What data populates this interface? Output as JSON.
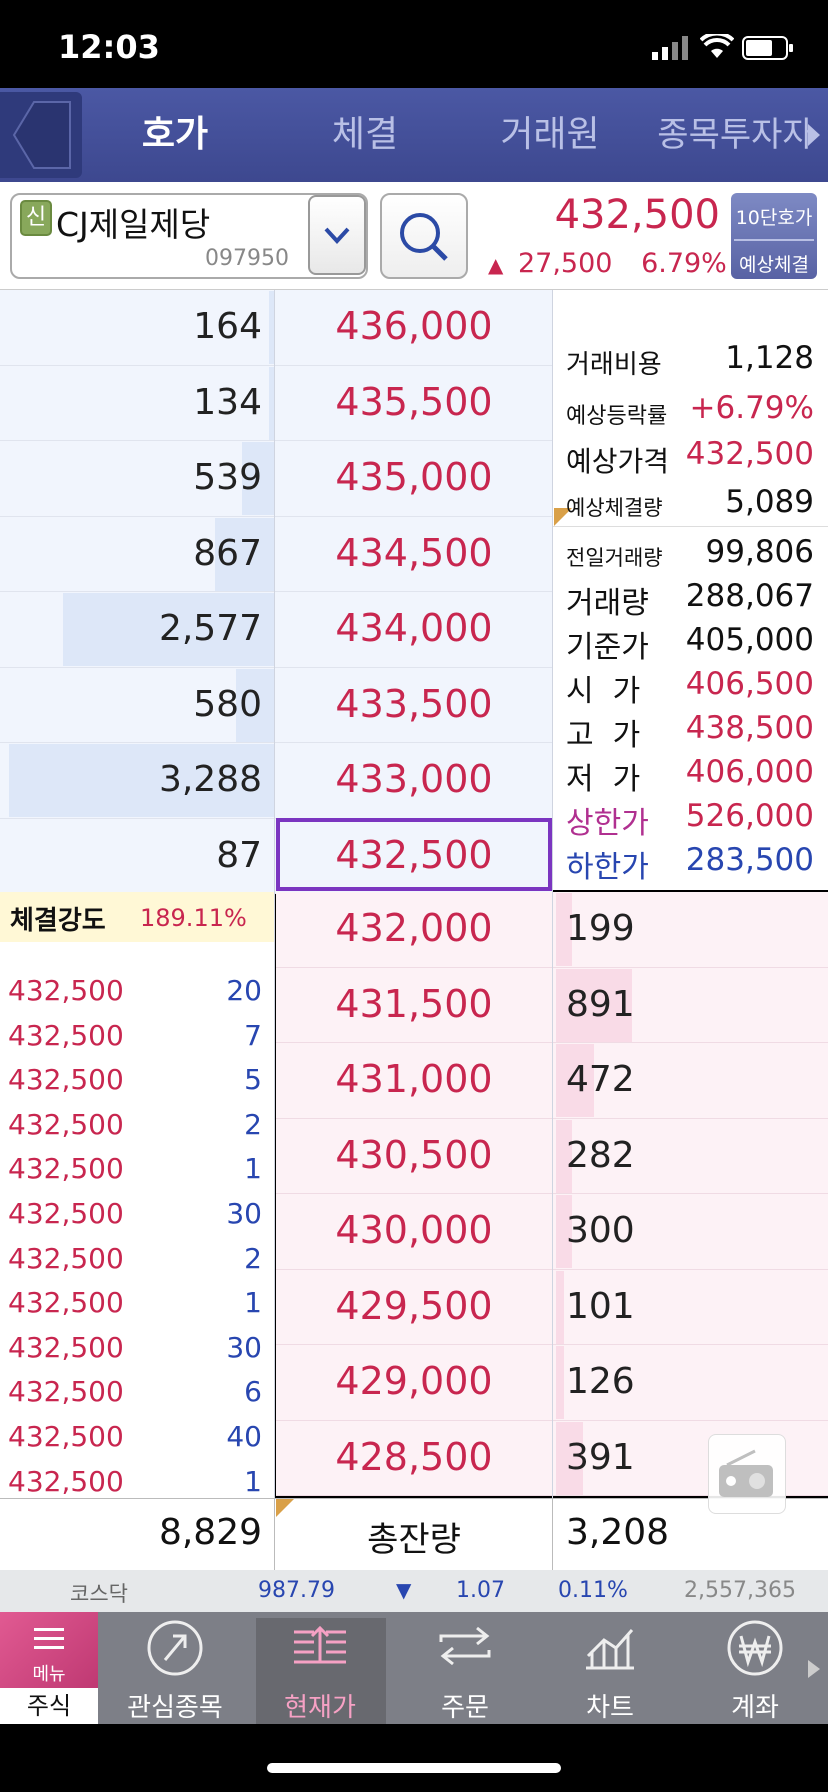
{
  "status": {
    "time": "12:03"
  },
  "tabs": [
    "호가",
    "체결",
    "거래원",
    "종목투자자"
  ],
  "stock": {
    "badge": "신",
    "name": "CJ제일제당",
    "code": "097950",
    "price": "432,500",
    "change_arrow": "▲",
    "change": "27,500",
    "rate": "6.79%"
  },
  "side_button": {
    "line1": "10단호가",
    "line2": "예상체결"
  },
  "asks": [
    {
      "qty": "164",
      "price": "436,000",
      "fill": 0.02
    },
    {
      "qty": "134",
      "price": "435,500",
      "fill": 0.02
    },
    {
      "qty": "539",
      "price": "435,000",
      "fill": 0.12
    },
    {
      "qty": "867",
      "price": "434,500",
      "fill": 0.22
    },
    {
      "qty": "2,577",
      "price": "434,000",
      "fill": 0.78
    },
    {
      "qty": "580",
      "price": "433,500",
      "fill": 0.14
    },
    {
      "qty": "3,288",
      "price": "433,000",
      "fill": 0.98
    },
    {
      "qty": "87",
      "price": "432,500",
      "fill": 0.0
    }
  ],
  "bids": [
    {
      "price": "432,000",
      "qty": "199",
      "fill": 0.06
    },
    {
      "price": "431,500",
      "qty": "891",
      "fill": 0.28
    },
    {
      "price": "431,000",
      "qty": "472",
      "fill": 0.14
    },
    {
      "price": "430,500",
      "qty": "282",
      "fill": 0.06
    },
    {
      "price": "430,000",
      "qty": "300",
      "fill": 0.06
    },
    {
      "price": "429,500",
      "qty": "101",
      "fill": 0.03
    },
    {
      "price": "429,000",
      "qty": "126",
      "fill": 0.03
    },
    {
      "price": "428,500",
      "qty": "391",
      "fill": 0.1
    }
  ],
  "info": {
    "fee_label": "거래비용",
    "fee_value": "1,128",
    "exp_rate_label": "예상등락률",
    "exp_rate_value": "+6.79%",
    "exp_price_label": "예상가격",
    "exp_price_value": "432,500",
    "exp_vol_label": "예상체결량",
    "exp_vol_value": "5,089",
    "prev_vol_label": "전일거래량",
    "prev_vol_value": "99,806",
    "vol_label": "거래량",
    "vol_value": "288,067",
    "base_label": "기준가",
    "base_value": "405,000",
    "open_label": "시  가",
    "open_value": "406,500",
    "high_label": "고  가",
    "high_value": "438,500",
    "low_label": "저  가",
    "low_value": "406,000",
    "upper_label": "상한가",
    "upper_value": "526,000",
    "lower_label": "하한가",
    "lower_value": "283,500"
  },
  "strength": {
    "label": "체결강도",
    "value": "189.11%"
  },
  "ticks": [
    {
      "price": "432,500",
      "vol": "20"
    },
    {
      "price": "432,500",
      "vol": "7"
    },
    {
      "price": "432,500",
      "vol": "5"
    },
    {
      "price": "432,500",
      "vol": "2"
    },
    {
      "price": "432,500",
      "vol": "1"
    },
    {
      "price": "432,500",
      "vol": "30"
    },
    {
      "price": "432,500",
      "vol": "2"
    },
    {
      "price": "432,500",
      "vol": "1"
    },
    {
      "price": "432,500",
      "vol": "30"
    },
    {
      "price": "432,500",
      "vol": "6"
    },
    {
      "price": "432,500",
      "vol": "40"
    },
    {
      "price": "432,500",
      "vol": "1"
    }
  ],
  "totals": {
    "ask_total": "8,829",
    "label": "총잔량",
    "bid_total": "3,208"
  },
  "market": {
    "name": "코스닥",
    "index": "987.79",
    "arrow": "▼",
    "change": "1.07",
    "rate": "0.11%",
    "volume": "2,557,365"
  },
  "nav": {
    "menu": "메뉴",
    "stock": "주식",
    "items": [
      "관심종목",
      "현재가",
      "주문",
      "차트",
      "계좌"
    ]
  },
  "colors": {
    "up": "#c8264f",
    "down": "#2846b0",
    "tabbar": "#46529a",
    "highlight": "#7b35c0"
  }
}
